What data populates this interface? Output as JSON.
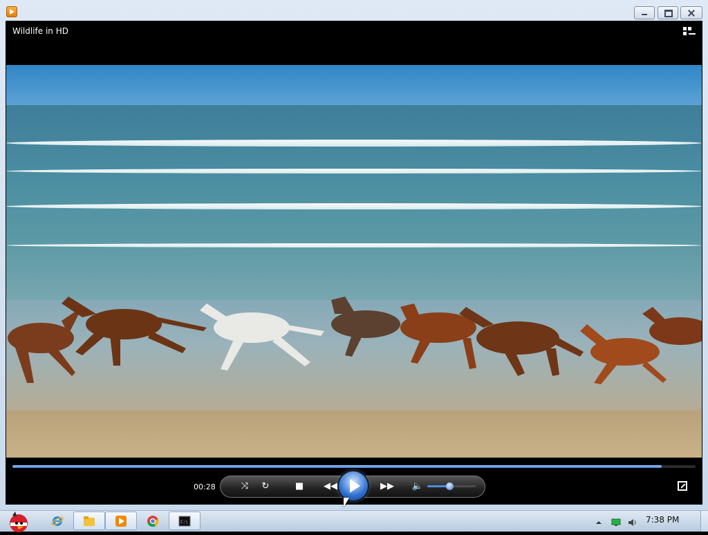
{
  "window": {
    "title": "Wildlife in HD",
    "buttons": {
      "minimize": "minimize",
      "maximize": "maximize",
      "close": "close"
    }
  },
  "player": {
    "current_time": "00:28",
    "progress_fraction": 0.95,
    "volume_fraction": 0.45,
    "accent": "#3c7ccf",
    "controls": [
      "shuffle-icon",
      "repeat-icon",
      "stop-icon",
      "previous-icon",
      "play-icon",
      "next-icon",
      "volume-icon"
    ]
  },
  "taskbar": {
    "items": [
      "start-button",
      "internet-explorer-icon",
      "windows-explorer-icon",
      "media-player-icon",
      "chrome-icon",
      "command-prompt-icon"
    ],
    "tray_icons": [
      "show-hidden-icons",
      "network-icon",
      "volume-icon"
    ],
    "clock": "7:38 PM"
  }
}
